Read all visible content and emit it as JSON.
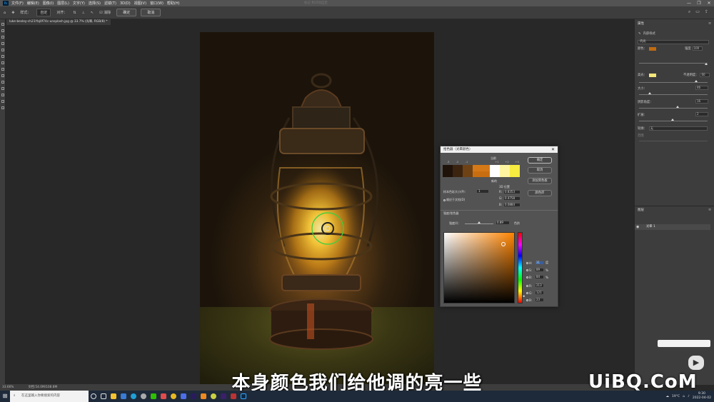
{
  "menubar": {
    "items": [
      "文件(F)",
      "编辑(E)",
      "图像(I)",
      "图层(L)",
      "文字(Y)",
      "选择(S)",
      "滤镜(T)",
      "3D(D)",
      "视图(V)",
      "窗口(W)",
      "帮助(H)"
    ],
    "title_faded": "标记  和识别自定  ",
    "window_buttons": [
      "—",
      "❐",
      "✕"
    ]
  },
  "options": {
    "mode_label": "样式：",
    "mode_value": "自定",
    "align_label": "对齐：",
    "checkbox_label": "消除",
    "confirm": "确定",
    "cancel": "取消"
  },
  "document_tab": "luke-besley-ch21Ybj0f74c-unsplash.jpg @ 33.7% (光晕, RGB/8) *",
  "status": {
    "zoom": "33.66%",
    "doc": "文档:54.0M/108.8M"
  },
  "properties": {
    "title": "属性",
    "tab": "内部样式",
    "effect_select": "内光",
    "color_label": "颜色：",
    "opacity_label": "强度",
    "opacity_value": "100",
    "light_label": "高光：",
    "light_opacity_label": "不透明度：",
    "light_opacity_value": "60",
    "size_label": "大小：",
    "size_value": "46",
    "shadow_label": "阴影角度：",
    "shadow_value": "16",
    "spread_label": "扩展：",
    "spread_value": "2",
    "contour_label": "轮廓：",
    "contour_value": "无",
    "range_label": "范围"
  },
  "layers": {
    "title": "图层",
    "layer_name": "光晕 1"
  },
  "dialog": {
    "title": "拾色器（光晕颜色）",
    "swatch_top_label": "当前",
    "swatch_bottom_label": "新的",
    "swatch_steps": [
      "-3",
      "-2",
      "-1",
      "+1",
      "+2",
      "+3"
    ],
    "sample_size_label": "样本色彩大小(P)：",
    "sample_size_value": "1",
    "checkbox_label": "顺应于文档(D)",
    "right_header": "3D 位置",
    "xyz": [
      {
        "label": "R:",
        "value": "0.8353"
      },
      {
        "label": "G:",
        "value": "0.4758"
      },
      {
        "label": "B:",
        "value": "0.0884"
      }
    ],
    "section_label": "强度/拾色器",
    "intensity_label": "强度(I)：",
    "intensity_value": "0.89",
    "intensity_unit": "色阶",
    "buttons": {
      "ok": "确定",
      "cancel": "取消",
      "add": "添加到色板",
      "libraries": "颜色库"
    },
    "hsb": [
      {
        "label": "H:",
        "value": "31",
        "unit": "度"
      },
      {
        "label": "S:",
        "value": "89",
        "unit": "%"
      },
      {
        "label": "B:",
        "value": "84",
        "unit": "%"
      }
    ],
    "rgb": [
      {
        "label": "R:",
        "value": "213"
      },
      {
        "label": "G:",
        "value": "121"
      },
      {
        "label": "B:",
        "value": "23"
      }
    ]
  },
  "subtitle": "本身颜色我们给他调的亮一些",
  "watermark": "UiBQ.CoM",
  "taskbar": {
    "search_placeholder": "在这里输入你要搜索的内容",
    "temperature": "19°C",
    "time": "9:30",
    "date": "2022-04-02"
  },
  "colors": {
    "current_swatch": "#d57817",
    "new_swatch": "#c96e10",
    "panel_color": "#c06a10",
    "light_color": "#f5e67a"
  }
}
